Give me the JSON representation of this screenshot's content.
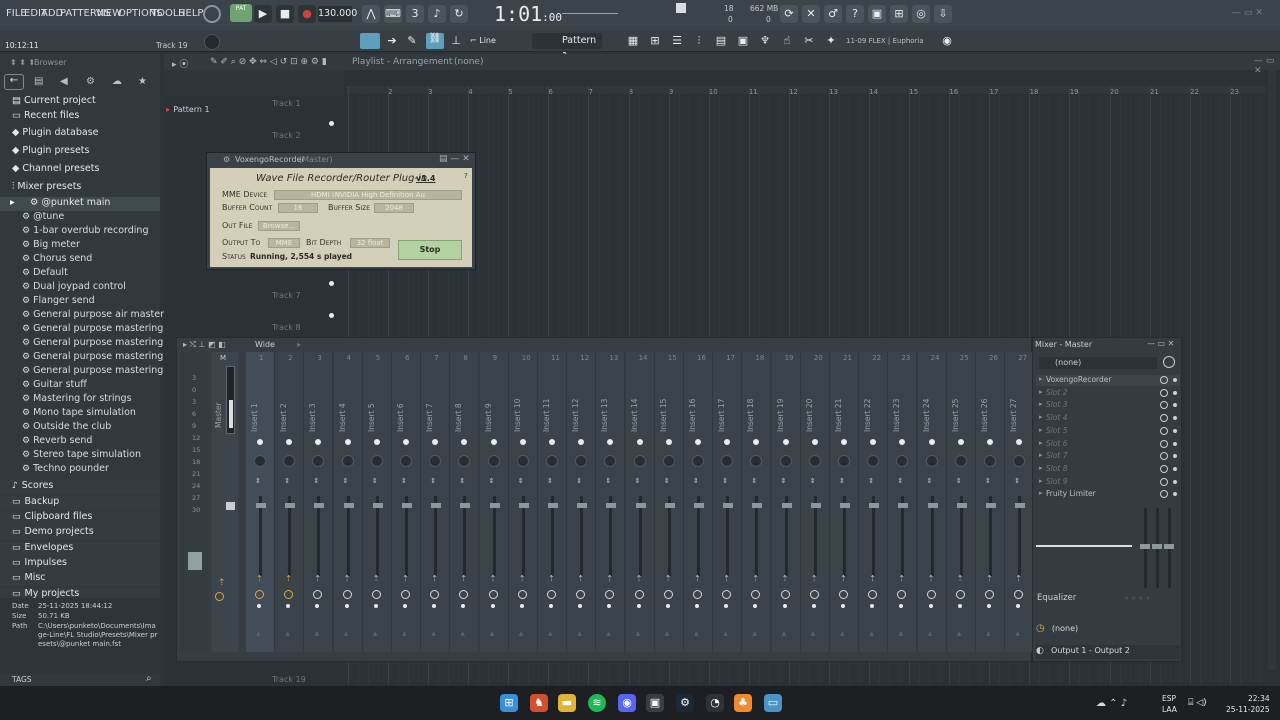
{
  "menu": [
    "FILE",
    "EDIT",
    "ADD",
    "PATTERNS",
    "VIEW",
    "OPTIONS",
    "TOOLS",
    "HELP"
  ],
  "transport": {
    "pat_label": "PAT",
    "tempo": "130.000",
    "time": "1:01",
    "time_sub": ":00",
    "cpu_top": "18",
    "cpu_bottom": "0",
    "mem_top": "662 MB",
    "mem_bottom": "0"
  },
  "info": {
    "clock": "10:12:11",
    "track": "Track 19"
  },
  "toolbar2": {
    "snap": "Line",
    "pattern": "Pattern 1",
    "news": "11-09  FLEX | Euphoria"
  },
  "browser": {
    "title": "Browser",
    "items": [
      {
        "label": "Current project",
        "icon": "project-icon"
      },
      {
        "label": "Recent files",
        "icon": "file-icon"
      },
      {
        "label": "Plugin database",
        "icon": "plug-icon"
      },
      {
        "label": "Plugin presets",
        "icon": "plug-icon"
      },
      {
        "label": "Channel presets",
        "icon": "plug-icon"
      },
      {
        "label": "Mixer presets",
        "icon": "mixer-icon"
      }
    ],
    "selected_preset": "@punket main",
    "presets": [
      "@tune",
      "1-bar overdub recording",
      "Big meter",
      "Chorus send",
      "Default",
      "Dual joypad control",
      "Flanger send",
      "General purpose air mastering",
      "General purpose mastering 2",
      "General purpose mastering 3",
      "General purpose mastering 4",
      "General purpose mastering",
      "Guitar stuff",
      "Mastering for strings",
      "Mono tape simulation",
      "Outside the club",
      "Reverb send",
      "Stereo tape simulation",
      "Techno pounder"
    ],
    "folders": [
      "Scores",
      "Backup",
      "Clipboard files",
      "Demo projects",
      "Envelopes",
      "Impulses",
      "Misc",
      "My projects"
    ],
    "meta": {
      "date_label": "Date",
      "date": "25-11-2025 18:44:12",
      "size_label": "Size",
      "size": "50.71 KB",
      "path_label": "Path",
      "path": "C:\\Users\\punketo\\Documents\\Image-Line\\FL Studio\\Presets\\Mixer presets\\@punket main.fst"
    },
    "tags": "TAGS"
  },
  "playlist": {
    "title": "Playlist - Arrangement",
    "context": "(none)",
    "pattern": "Pattern 1",
    "ruler": [
      "2",
      "3",
      "4",
      "5",
      "6",
      "7",
      "8",
      "9",
      "10",
      "11",
      "12",
      "13",
      "14",
      "15",
      "16",
      "17",
      "18",
      "19",
      "20",
      "21",
      "22",
      "23"
    ],
    "tracks": [
      "Track 1",
      "Track 2",
      "Track 7",
      "Track 8",
      "Track 19"
    ]
  },
  "plugin": {
    "window_title": "VoxengoRecorder",
    "window_sub": "(Master)",
    "heading": "Wave File Recorder/Router Plug-in",
    "version": "v1.4",
    "mme_label": "MME Device",
    "mme_value": "HDMI (NVIDIA High Definition Au",
    "buffer_count_label": "Buffer Count",
    "buffer_count": "16",
    "buffer_size_label": "Buffer Size",
    "buffer_size": "2048",
    "out_file_label": "Out File",
    "browse": "Browse...",
    "output_to_label": "Output To",
    "output_to": "MME",
    "bit_depth_label": "Bit Depth",
    "bit_depth": "32 float",
    "status_label": "Status",
    "status": "Running, 2,554 s played",
    "stop": "Stop"
  },
  "mixer": {
    "view_mode": "Wide",
    "master_label": "Master",
    "master_letter": "M",
    "db_scale": [
      "3",
      "0",
      "3",
      "6",
      "9",
      "12",
      "15",
      "18",
      "21",
      "24",
      "27",
      "30"
    ],
    "inserts": [
      "Insert 1",
      "Insert 2",
      "Insert 3",
      "Insert 4",
      "Insert 5",
      "Insert 6",
      "Insert 7",
      "Insert 8",
      "Insert 9",
      "Insert 10",
      "Insert 11",
      "Insert 12",
      "Insert 13",
      "Insert 14",
      "Insert 15",
      "Insert 16",
      "Insert 17",
      "Insert 18",
      "Insert 19",
      "Insert 20",
      "Insert 21",
      "Insert 22",
      "Insert 23",
      "Insert 24",
      "Insert 25",
      "Insert 26",
      "Insert 27"
    ]
  },
  "mixer_panel": {
    "title": "Mixer - Master",
    "preset": "(none)",
    "slots": [
      "VoxengoRecorder",
      "Slot 2",
      "Slot 3",
      "Slot 4",
      "Slot 5",
      "Slot 6",
      "Slot 7",
      "Slot 8",
      "Slot 9",
      "Fruity Limiter"
    ],
    "eq_label": "Equalizer",
    "input": "(none)",
    "output": "Output 1 - Output 2"
  },
  "taskbar": {
    "lang_top": "ESP",
    "lang_bottom": "LAA",
    "time": "22:34",
    "date": "25-11-2025"
  },
  "colors": {
    "accent": "#4e9a52",
    "record": "#d0443c",
    "bg": "#2d3338",
    "plugin_bg": "#d3cfb8"
  }
}
